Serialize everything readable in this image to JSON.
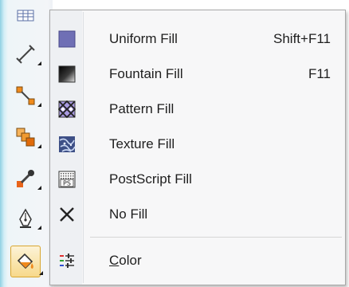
{
  "toolbox": {
    "tools": [
      {
        "name": "table-tool-icon"
      },
      {
        "name": "dimension-tool-icon"
      },
      {
        "name": "connector-tool-icon"
      },
      {
        "name": "blend-tool-icon"
      },
      {
        "name": "eyedropper-tool-icon"
      },
      {
        "name": "outline-pen-tool-icon"
      },
      {
        "name": "fill-tool-icon",
        "selected": true
      }
    ]
  },
  "menu": {
    "items": [
      {
        "label": "Uniform Fill",
        "shortcut": "Shift+F11",
        "icon": "uniform-fill-icon"
      },
      {
        "label": "Fountain Fill",
        "shortcut": "F11",
        "icon": "fountain-fill-icon"
      },
      {
        "label": "Pattern Fill",
        "shortcut": "",
        "icon": "pattern-fill-icon"
      },
      {
        "label": "Texture Fill",
        "shortcut": "",
        "icon": "texture-fill-icon"
      },
      {
        "label": "PostScript Fill",
        "shortcut": "",
        "icon": "postscript-fill-icon",
        "icon_text": "PS"
      },
      {
        "label": "No Fill",
        "shortcut": "",
        "icon": "no-fill-icon"
      }
    ],
    "color_item": {
      "label_first": "C",
      "label_rest": "olor",
      "icon": "color-docker-icon"
    }
  },
  "colors": {
    "uniform_fill": "#6f6fb5",
    "menu_bg": "#f7f7f8",
    "accent_orange": "#f08a1c"
  }
}
